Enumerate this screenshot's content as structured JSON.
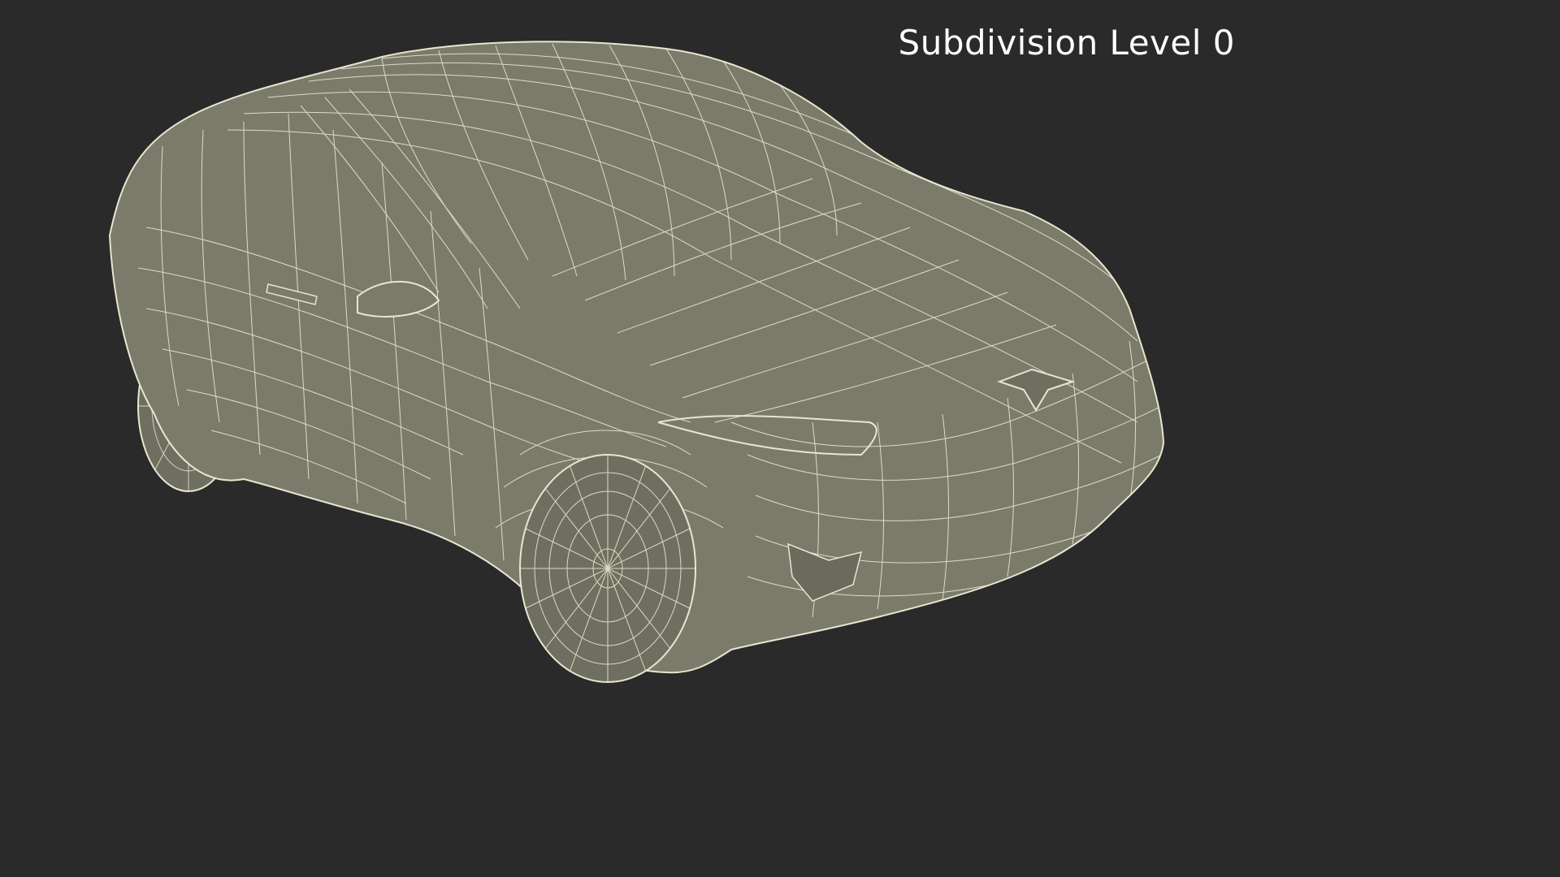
{
  "overlay": {
    "label": "Subdivision Level 0"
  },
  "render": {
    "background": "#2a2a2a",
    "surface_color": "#7b7b6c",
    "wire_color": "#e8e6cf"
  }
}
